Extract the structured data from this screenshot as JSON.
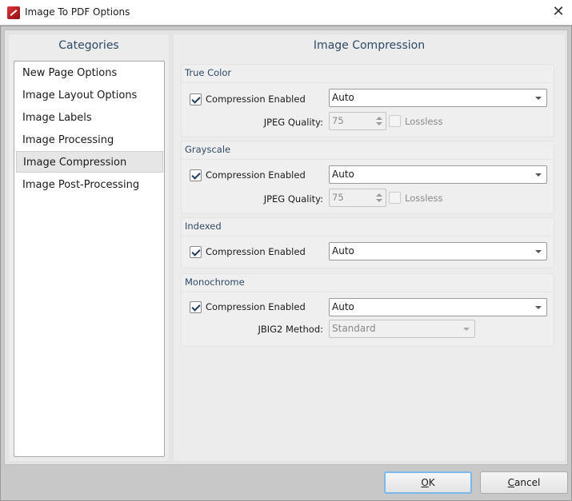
{
  "window": {
    "title": "Image To PDF Options",
    "close_icon": "close-icon"
  },
  "categories": {
    "heading": "Categories",
    "items": [
      "New Page Options",
      "Image Layout Options",
      "Image Labels",
      "Image Processing",
      "Image Compression",
      "Image Post-Processing"
    ],
    "selected": "Image Compression"
  },
  "main": {
    "heading": "Image Compression",
    "groups": {
      "true_color": {
        "title": "True Color",
        "compression_label": "Compression Enabled",
        "compression_checked": true,
        "method": "Auto",
        "quality_label": "JPEG Quality:",
        "quality": "75",
        "lossless_label": "Lossless",
        "lossless_checked": false
      },
      "grayscale": {
        "title": "Grayscale",
        "compression_label": "Compression Enabled",
        "compression_checked": true,
        "method": "Auto",
        "quality_label": "JPEG Quality:",
        "quality": "75",
        "lossless_label": "Lossless",
        "lossless_checked": false
      },
      "indexed": {
        "title": "Indexed",
        "compression_label": "Compression Enabled",
        "compression_checked": true,
        "method": "Auto"
      },
      "monochrome": {
        "title": "Monochrome",
        "compression_label": "Compression Enabled",
        "compression_checked": true,
        "method": "Auto",
        "jbig2_label": "JBIG2 Method:",
        "jbig2": "Standard"
      }
    }
  },
  "buttons": {
    "ok_key": "O",
    "ok_rest": "K",
    "cancel_key": "C",
    "cancel_rest": "ancel"
  }
}
